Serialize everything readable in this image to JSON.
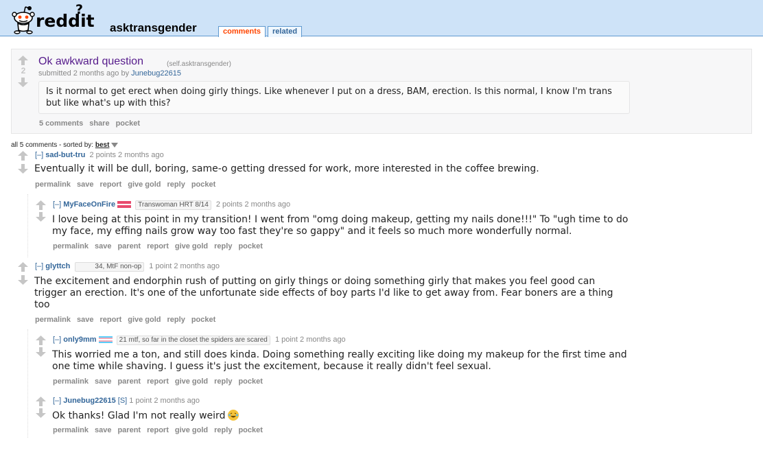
{
  "header": {
    "logo_text": "reddit",
    "logo_mark": "?",
    "subreddit": "asktransgender",
    "tabs": [
      {
        "label": "comments",
        "selected": true
      },
      {
        "label": "related",
        "selected": false
      }
    ]
  },
  "post": {
    "score": "2",
    "title": "Ok awkward question",
    "domain": "(self.asktransgender)",
    "submitted": "submitted 2 months ago by",
    "author": "Junebug22615",
    "body": "Is it normal to get erect when doing girly things. Like whenever I put on a dress, BAM, erection. Is this normal, I know I'm trans but like what's up with this?",
    "buttons": [
      "5 comments",
      "share",
      "pocket"
    ]
  },
  "comment_area": {
    "count_text": "all 5 comments",
    "sorted_by": "sorted by:",
    "sort_value": "best"
  },
  "comments": [
    {
      "toggle": "[–]",
      "author": "sad-but-tru",
      "flair": "",
      "meta": "2 points 2 months ago",
      "body": "Eventually it will be dull, boring, same-o getting dressed for work, more interested in the coffee brewing.",
      "buttons": [
        "permalink",
        "save",
        "report",
        "give gold",
        "reply",
        "pocket"
      ]
    },
    {
      "toggle": "[–]",
      "author": "MyFaceOnFire",
      "flair": "Transwoman HRT 8/14",
      "meta": "2 points 2 months ago",
      "body": "I love being at this point in my transition! I went from \"omg doing makeup, getting my nails done!!!\" To \"ugh time to do my face, my effing nails grow way too fast they're so gappy\" and it feels so much more wonderfully normal.",
      "buttons": [
        "permalink",
        "save",
        "parent",
        "report",
        "give gold",
        "reply",
        "pocket"
      ]
    },
    {
      "toggle": "[–]",
      "author": "glyttch",
      "flair": "34, MtF non-op",
      "meta": "1 point 2 months ago",
      "body": "The excitement and endorphin rush of putting on girly things or doing something girly that makes you feel good can trigger an erection. It's one of the unfortunate side effects of boy parts I'd like to get away from. Fear boners are a thing too",
      "buttons": [
        "permalink",
        "save",
        "report",
        "give gold",
        "reply",
        "pocket"
      ]
    },
    {
      "toggle": "[–]",
      "author": "only9mm",
      "flair": "21 mtf, so far in the closet the spiders are scared",
      "meta": "1 point 2 months ago",
      "body": "This worried me a ton, and still does kinda. Doing something really exciting like doing my makeup for the first time and one time while shaving. I guess it's just the excitement, because it really didn't feel sexual.",
      "buttons": [
        "permalink",
        "save",
        "parent",
        "report",
        "give gold",
        "reply",
        "pocket"
      ]
    },
    {
      "toggle": "[–]",
      "author": "Junebug22615",
      "submitter": "[S]",
      "flair": "",
      "meta": "1 point 2 months ago",
      "body": "Ok thanks! Glad I'm not really weird",
      "buttons": [
        "permalink",
        "save",
        "parent",
        "report",
        "give gold",
        "reply",
        "pocket"
      ]
    }
  ],
  "colors": {
    "header_bg": "#cee3f8",
    "link_color": "#369",
    "visited_title": "#551a8b",
    "muted": "#888888",
    "selected_tab": "#ff4500"
  }
}
